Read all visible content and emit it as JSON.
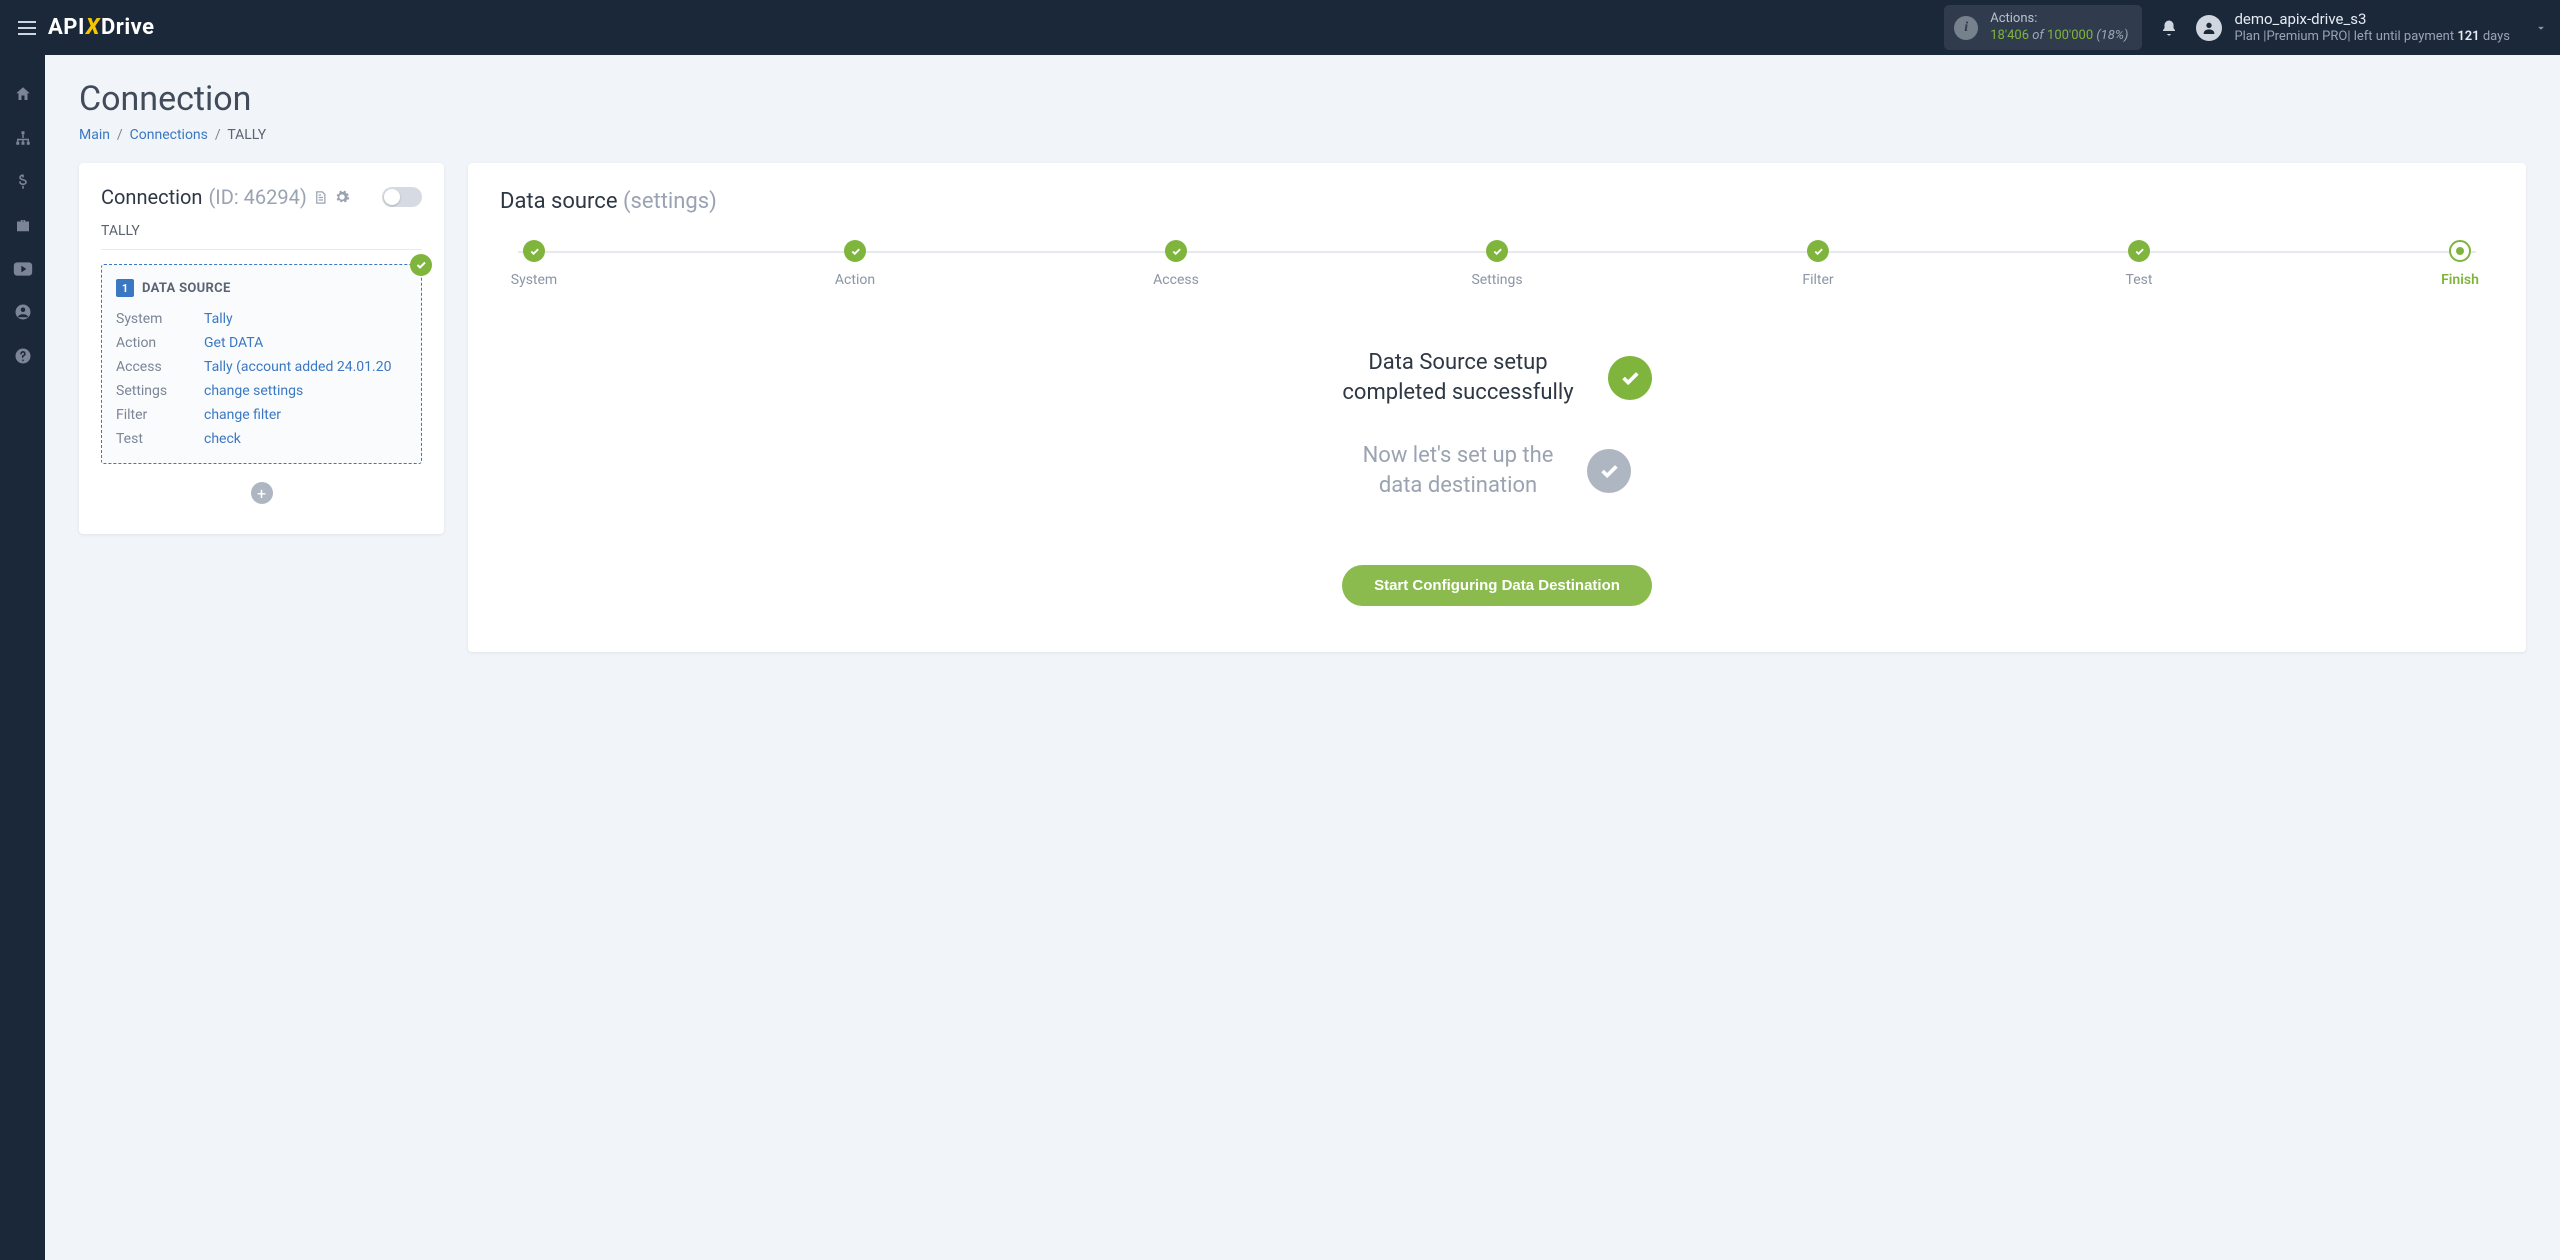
{
  "brand": {
    "part1": "API",
    "x": "X",
    "part2": "Drive"
  },
  "topbar": {
    "actions_label": "Actions:",
    "actions_used": "18'406",
    "actions_of": " of ",
    "actions_quota": "100'000",
    "actions_pct": " (18%)",
    "user_name": "demo_apix-drive_s3",
    "plan_prefix": "Plan |Premium PRO| left until payment ",
    "plan_days": "121",
    "plan_suffix": " days"
  },
  "page": {
    "title": "Connection",
    "breadcrumb": {
      "main": "Main",
      "connections": "Connections",
      "current": "TALLY"
    }
  },
  "left": {
    "title": "Connection",
    "id_label": "(ID: 46294)",
    "conn_name": "TALLY",
    "ds_badge": "1",
    "ds_title": "DATA SOURCE",
    "rows": {
      "system": {
        "label": "System",
        "value": "Tally"
      },
      "action": {
        "label": "Action",
        "value": "Get DATA"
      },
      "access": {
        "label": "Access",
        "value": "Tally (account added 24.01.20"
      },
      "settings": {
        "label": "Settings",
        "value": "change settings"
      },
      "filter": {
        "label": "Filter",
        "value": "change filter"
      },
      "test": {
        "label": "Test",
        "value": "check"
      }
    }
  },
  "right": {
    "title": "Data source",
    "subtitle": "(settings)",
    "steps": [
      "System",
      "Action",
      "Access",
      "Settings",
      "Filter",
      "Test",
      "Finish"
    ],
    "success_line1": "Data Source setup",
    "success_line2": "completed successfully",
    "next_line1": "Now let's set up the",
    "next_line2": "data destination",
    "cta": "Start Configuring Data Destination"
  }
}
